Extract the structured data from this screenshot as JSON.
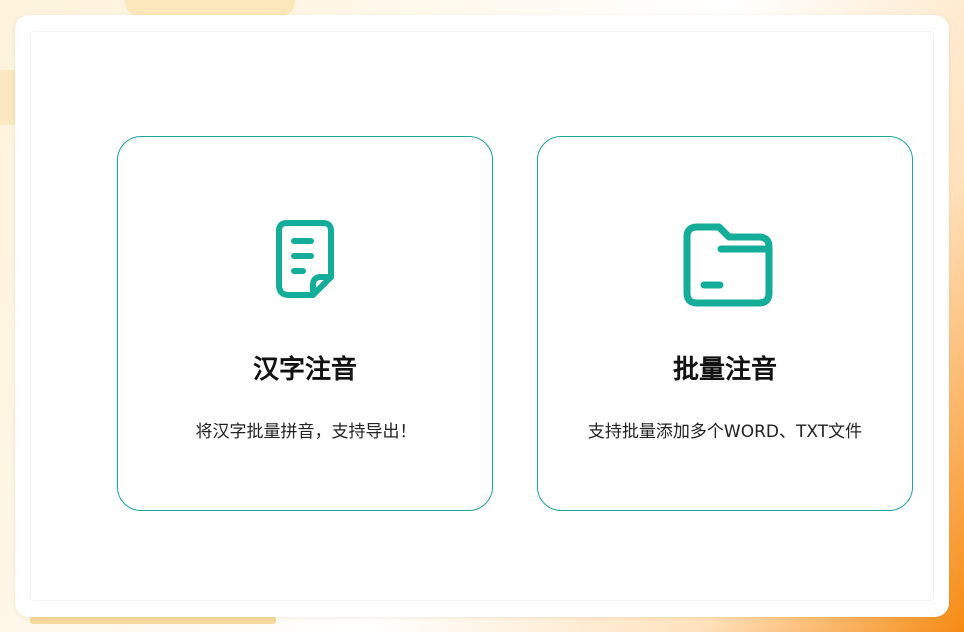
{
  "colors": {
    "accent": "#17a69b",
    "icon": "#14ad99"
  },
  "cards": [
    {
      "icon": "document-icon",
      "title": "汉字注音",
      "description": "将汉字批量拼音，支持导出！"
    },
    {
      "icon": "folder-icon",
      "title": "批量注音",
      "description": "支持批量添加多个WORD、TXT文件"
    }
  ]
}
